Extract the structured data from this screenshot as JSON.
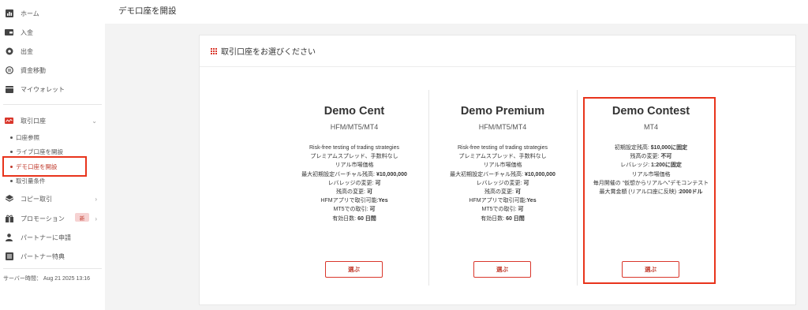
{
  "sidebar": {
    "items": [
      {
        "label": "ホーム",
        "icon": "chart-icon"
      },
      {
        "label": "入金",
        "icon": "wallet-in-icon"
      },
      {
        "label": "出金",
        "icon": "withdraw-icon"
      },
      {
        "label": "資金移動",
        "icon": "transfer-icon"
      },
      {
        "label": "マイウォレット",
        "icon": "wallet-icon"
      }
    ],
    "trading_accounts": {
      "label": "取引口座",
      "icon": "trading-icon",
      "sub_items": [
        {
          "label": "口座参照"
        },
        {
          "label": "ライブ口座を開設"
        },
        {
          "label": "デモ口座を開設"
        },
        {
          "label": "取引量条件"
        }
      ]
    },
    "copy_trading": {
      "label": "コピー取引",
      "icon": "copy-icon"
    },
    "promotion": {
      "label": "プロモーション",
      "badge": "新",
      "icon": "gift-icon"
    },
    "partner_apply": {
      "label": "パートナーに申請",
      "icon": "person-icon"
    },
    "partner_benefits": {
      "label": "パートナー特典",
      "icon": "list-icon"
    },
    "server_time": "サーバー時間： Aug 21 2025 13:16"
  },
  "page": {
    "title": "デモ口座を開設",
    "panel_title": "取引口座をお選びください"
  },
  "cards": [
    {
      "title": "Demo Cent",
      "platform": "HFM/MT5/MT4",
      "features": [
        {
          "text": "Risk-free testing of trading strategies",
          "value": ""
        },
        {
          "text": "プレミアムスプレッド、手数料なし",
          "value": ""
        },
        {
          "text": "リアル市場価格",
          "value": ""
        },
        {
          "text": "最大初期設定バーチャル残高: ",
          "value": "¥10,000,000"
        },
        {
          "text": "レバレッジの変更: ",
          "value": "可"
        },
        {
          "text": "残高の変更: ",
          "value": "可"
        },
        {
          "text": "HFMアプリで取引可能:",
          "value": "Yes"
        },
        {
          "text": "MT5での取引: ",
          "value": "可"
        },
        {
          "text": "有効日数: ",
          "value": "60 日間"
        }
      ],
      "button": "選ぶ"
    },
    {
      "title": "Demo Premium",
      "platform": "HFM/MT5/MT4",
      "features": [
        {
          "text": "Risk-free testing of trading strategies",
          "value": ""
        },
        {
          "text": "プレミアムスプレッド、手数料なし",
          "value": ""
        },
        {
          "text": "リアル市場価格",
          "value": ""
        },
        {
          "text": "最大初期設定バーチャル残高: ",
          "value": "¥10,000,000"
        },
        {
          "text": "レバレッジの変更: ",
          "value": "可"
        },
        {
          "text": "残高の変更: ",
          "value": "可"
        },
        {
          "text": "HFMアプリで取引可能:",
          "value": "Yes"
        },
        {
          "text": "MT5での取引: ",
          "value": "可"
        },
        {
          "text": "有効日数: ",
          "value": "60 日間"
        }
      ],
      "button": "選ぶ"
    },
    {
      "title": "Demo Contest",
      "platform": "MT4",
      "features": [
        {
          "text": "初期設定残高: ",
          "value": "$10,000に固定"
        },
        {
          "text": "残高の変更: ",
          "value": "不可"
        },
        {
          "text": "レバレッジ: ",
          "value": "1:200に固定"
        },
        {
          "text": "リアル市場価格",
          "value": ""
        },
        {
          "text": "毎月開催の “仮想からリアルへ”デモコンテスト",
          "value": ""
        },
        {
          "text": "最大賞金額 (リアル口座に反映) :",
          "value": "2000ドル"
        }
      ],
      "button": "選ぶ"
    }
  ],
  "colors": {
    "accent": "#d9362b",
    "highlight": "#e8341c",
    "background": "#f3f3f3"
  }
}
